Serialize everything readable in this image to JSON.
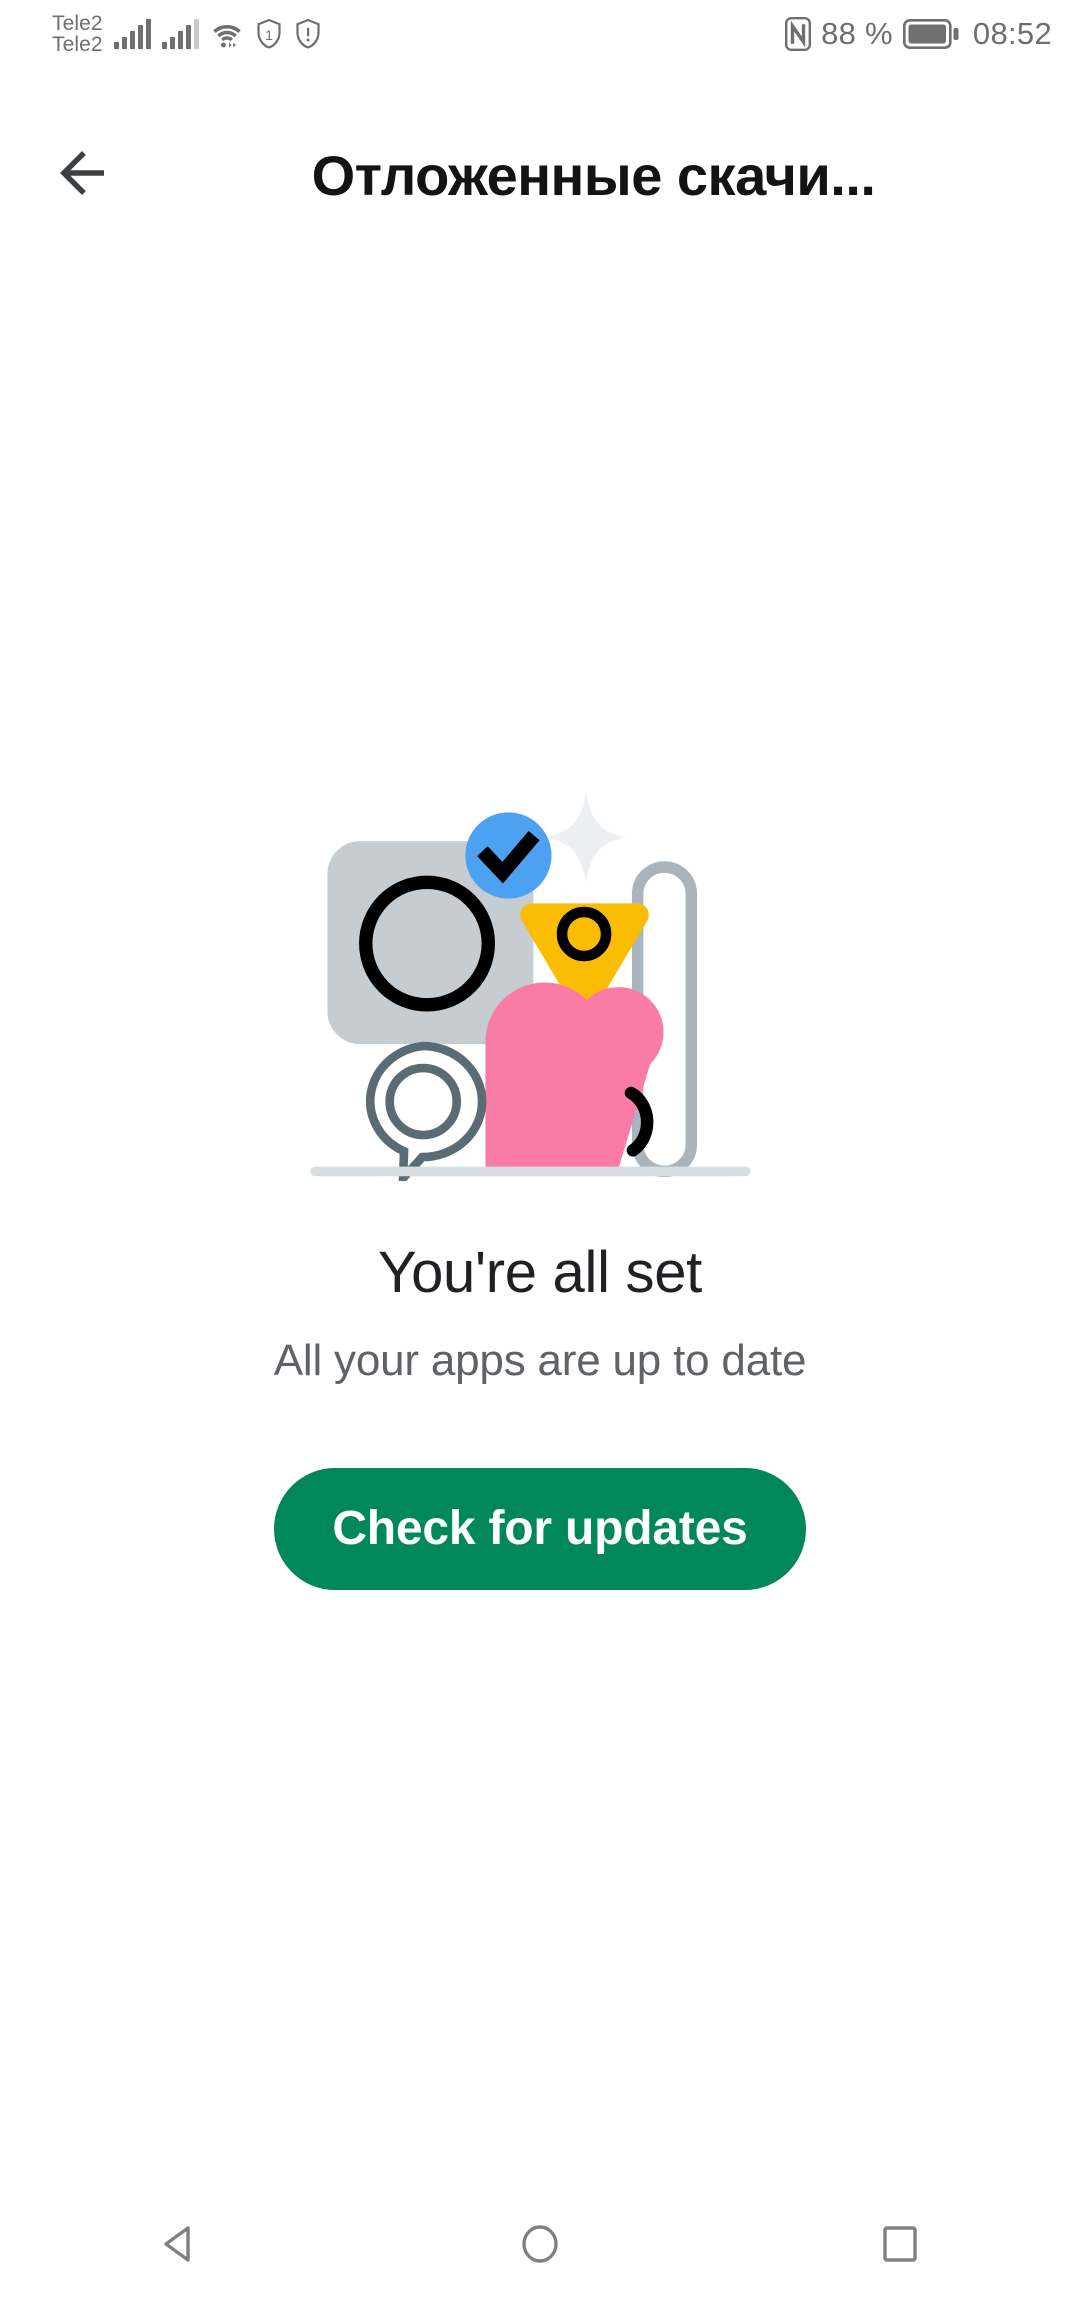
{
  "status_bar": {
    "carriers": [
      "Tele2",
      "Tele2"
    ],
    "signal_icons": [
      "signal-bars-sim1",
      "signal-bars-sim2"
    ],
    "wifi_icon": "wifi-icon",
    "shield_one_icon": "shield-one-icon",
    "shield_alert_icon": "shield-alert-icon",
    "nfc_icon": "nfc-icon",
    "battery_percent": "88 %",
    "battery_icon": "battery-icon",
    "time": "08:52"
  },
  "app_bar": {
    "back_icon": "back-arrow-icon",
    "title": "Отложенные скачи..."
  },
  "illustration": {
    "name": "all-set-illustration",
    "colors": {
      "gray_square": "#C5CDD2",
      "blue_badge": "#4CA2F0",
      "yellow_triangle": "#FBBC04",
      "pink_heart": "#FA7BA5",
      "outline_gray": "#A9B4BC",
      "sparkle": "#EDF0F2",
      "shelf": "#D9DEE1",
      "speech_outline": "#5A6B74",
      "black": "#000000"
    }
  },
  "main": {
    "headline": "You're all set",
    "subhead": "All your apps are up to date",
    "cta_label": "Check for updates",
    "cta_color": "#00875A"
  },
  "nav_bar": {
    "back_label": "back-triangle-icon",
    "home_label": "home-circle-icon",
    "recents_label": "recents-square-icon"
  }
}
